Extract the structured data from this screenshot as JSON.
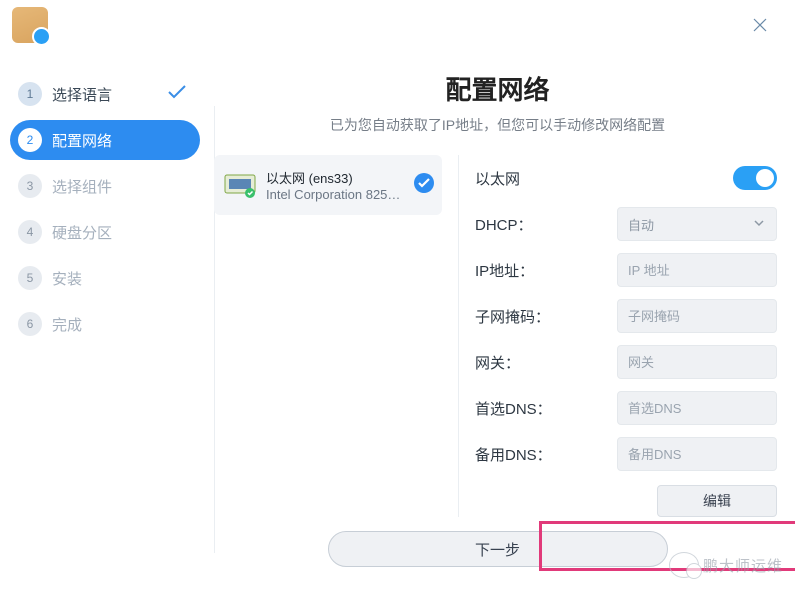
{
  "header": {
    "title": "配置网络",
    "subtitle": "已为您自动获取了IP地址，但您可以手动修改网络配置"
  },
  "sidebar": {
    "items": [
      {
        "num": "1",
        "label": "选择语言",
        "state": "completed"
      },
      {
        "num": "2",
        "label": "配置网络",
        "state": "active"
      },
      {
        "num": "3",
        "label": "选择组件",
        "state": "future"
      },
      {
        "num": "4",
        "label": "硬盘分区",
        "state": "future"
      },
      {
        "num": "5",
        "label": "安装",
        "state": "future"
      },
      {
        "num": "6",
        "label": "完成",
        "state": "future"
      }
    ]
  },
  "nic": {
    "name": "以太网 (ens33)",
    "desc": "Intel Corporation 825…"
  },
  "settings": {
    "ethernet_label": "以太网",
    "ethernet_on": true,
    "dhcp_label": "DHCP：",
    "dhcp_value": "自动",
    "ip_label": "IP地址：",
    "ip_placeholder": "IP 地址",
    "mask_label": "子网掩码：",
    "mask_placeholder": "子网掩码",
    "gw_label": "网关：",
    "gw_placeholder": "网关",
    "dns1_label": "首选DNS：",
    "dns1_placeholder": "首选DNS",
    "dns2_label": "备用DNS：",
    "dns2_placeholder": "备用DNS",
    "edit_label": "编辑"
  },
  "footer": {
    "next_label": "下一步"
  },
  "watermark": "鹏大师运维"
}
